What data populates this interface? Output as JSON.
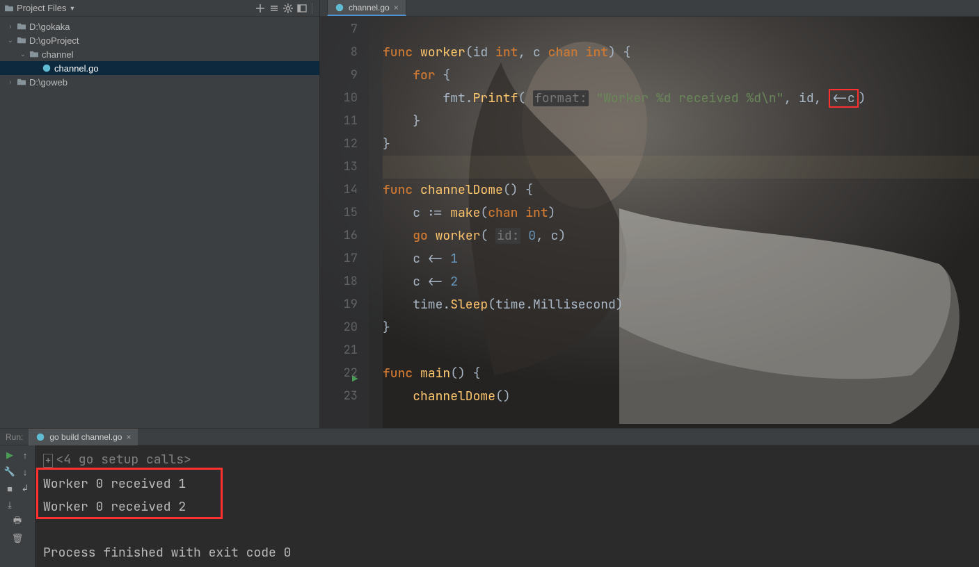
{
  "sidebar": {
    "title": "Project Files",
    "tree": [
      {
        "depth": 0,
        "expander": "›",
        "type": "folder",
        "label": "D:\\gokaka",
        "selected": false
      },
      {
        "depth": 0,
        "expander": "⌄",
        "type": "folder",
        "label": "D:\\goProject",
        "selected": false
      },
      {
        "depth": 1,
        "expander": "⌄",
        "type": "folder",
        "label": "channel",
        "selected": false
      },
      {
        "depth": 2,
        "expander": "",
        "type": "gofile",
        "label": "channel.go",
        "selected": true
      },
      {
        "depth": 0,
        "expander": "›",
        "type": "folder",
        "label": "D:\\goweb",
        "selected": false
      }
    ]
  },
  "editor": {
    "tab_label": "channel.go",
    "first_line_no": 7,
    "highlight_line_no": 13,
    "run_icon_line_no": 22,
    "lines": [
      {
        "n": 7,
        "html": ""
      },
      {
        "n": 8,
        "html": "<span class=\"kw\">func</span> <span class=\"fn\">worker</span>(id <span class=\"kw\">int</span>, c <span class=\"kw\">chan</span> <span class=\"kw\">int</span>) {"
      },
      {
        "n": 9,
        "html": "    <span class=\"kw\">for</span> {"
      },
      {
        "n": 10,
        "html": "        fmt.<span class=\"fn\">Printf</span>( <span class=\"hint hint-bg\">format:</span> <span class=\"str\">\"Worker %d received %d\\n\"</span>, id, <span class=\"redbox\">&lt;-c</span>)"
      },
      {
        "n": 11,
        "html": "    }"
      },
      {
        "n": 12,
        "html": "}"
      },
      {
        "n": 13,
        "html": ""
      },
      {
        "n": 14,
        "html": "<span class=\"kw\">func</span> <span class=\"fn\">channelDome</span>() {"
      },
      {
        "n": 15,
        "html": "    c := <span class=\"fn\">make</span>(<span class=\"kw\">chan</span> <span class=\"kw\">int</span>)"
      },
      {
        "n": 16,
        "html": "    <span class=\"kw\">go</span> <span class=\"fn\">worker</span>( <span class=\"hint hint-bg\">id:</span> <span class=\"num\">0</span>, c)"
      },
      {
        "n": 17,
        "html": "    c &lt;- <span class=\"num\">1</span>"
      },
      {
        "n": 18,
        "html": "    c &lt;- <span class=\"num\">2</span>"
      },
      {
        "n": 19,
        "html": "    time.<span class=\"fn\">Sleep</span>(time.Millisecond)"
      },
      {
        "n": 20,
        "html": "}"
      },
      {
        "n": 21,
        "html": ""
      },
      {
        "n": 22,
        "html": "<span class=\"kw\">func</span> <span class=\"fn\">main</span>() {"
      },
      {
        "n": 23,
        "html": "    <span class=\"fn\">channelDome</span>()"
      }
    ]
  },
  "run": {
    "label": "Run:",
    "tab": "go build channel.go",
    "setup_line": "<4 go setup calls>",
    "output": [
      "Worker 0 received 1",
      "Worker 0 received 2"
    ],
    "exit_line": "Process finished with exit code 0"
  }
}
